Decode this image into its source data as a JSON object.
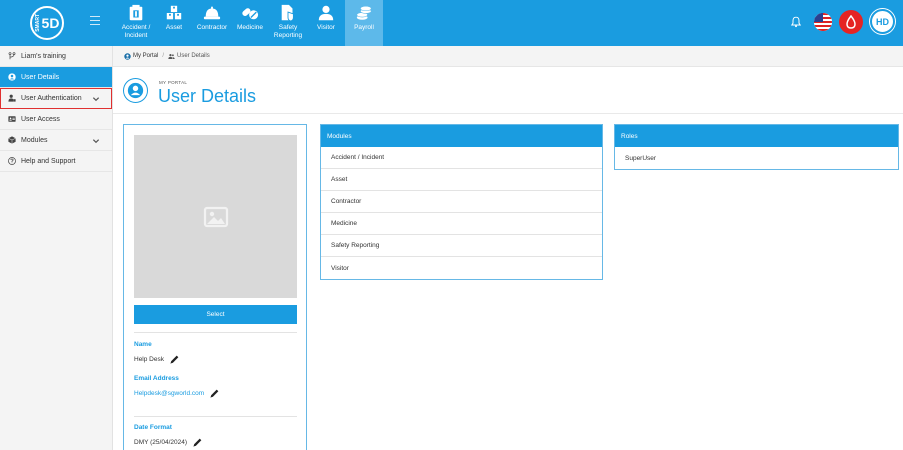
{
  "app": {
    "logo_text": "5D",
    "logo_small": "SMART"
  },
  "top_nav": {
    "tabs": [
      {
        "label": "Accident /\nIncident",
        "icon": "accident-icon"
      },
      {
        "label": "Asset",
        "icon": "asset-icon"
      },
      {
        "label": "Contractor",
        "icon": "contractor-icon"
      },
      {
        "label": "Medicine",
        "icon": "medicine-icon"
      },
      {
        "label": "Safety\nReporting",
        "icon": "safety-reporting-icon"
      },
      {
        "label": "Visitor",
        "icon": "visitor-icon"
      },
      {
        "label": "Payroll",
        "icon": "payroll-icon",
        "active": true
      }
    ],
    "avatar_initials": "HD"
  },
  "sidebar": {
    "items": [
      {
        "label": "Liam's training",
        "icon": "branch-icon"
      },
      {
        "label": "User Details",
        "icon": "user-circle-icon",
        "active": true
      },
      {
        "label": "User Authentication",
        "icon": "user-lock-icon",
        "has_chevron": true
      },
      {
        "label": "User Access",
        "icon": "id-card-icon"
      },
      {
        "label": "Modules",
        "icon": "cube-icon",
        "has_chevron": true
      },
      {
        "label": "Help and Support",
        "icon": "question-icon"
      }
    ]
  },
  "breadcrumb": {
    "items": [
      "My Portal",
      "User Details"
    ]
  },
  "page": {
    "subtitle": "MY PORTAL",
    "title": "User Details"
  },
  "profile": {
    "select_label": "Select",
    "name_label": "Name",
    "name_value": "Help Desk",
    "email_label": "Email Address",
    "email_value": "Helpdesk@sgworld.com",
    "date_format_label": "Date Format",
    "date_format_value": "DMY (25/04/2024)"
  },
  "modules_panel": {
    "header": "Modules",
    "items": [
      "Accident / Incident",
      "Asset",
      "Contractor",
      "Medicine",
      "Safety Reporting",
      "Visitor"
    ]
  },
  "roles_panel": {
    "header": "Roles",
    "items": [
      "SuperUser"
    ]
  },
  "colors": {
    "primary": "#1a9ce0",
    "active_tab": "#5db9ea",
    "highlight_border": "#e03030",
    "alert": "#e52424"
  }
}
